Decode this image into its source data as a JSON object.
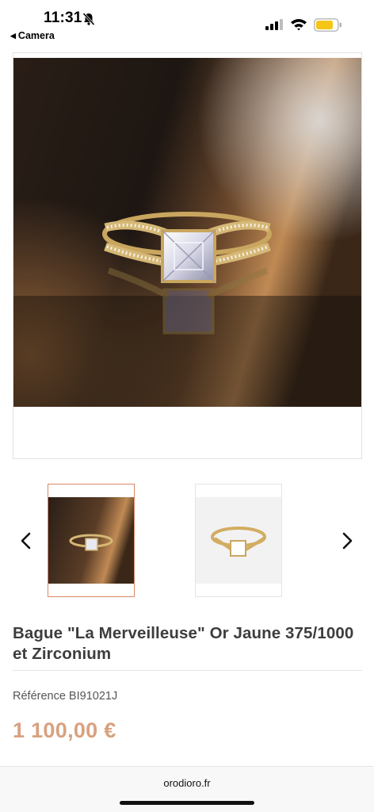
{
  "status_bar": {
    "time": "11:31",
    "back_label": "Camera",
    "icons": [
      "bell-slash-icon",
      "cellular-signal-icon",
      "wifi-icon",
      "battery-icon"
    ],
    "battery_color": "#f5c518"
  },
  "gallery": {
    "main_image": "ring-photo",
    "thumbnails": [
      {
        "name": "thumb-ring-dark",
        "selected": true
      },
      {
        "name": "thumb-ring-white",
        "selected": false
      }
    ],
    "prev_icon": "chevron-left-icon",
    "next_icon": "chevron-right-icon"
  },
  "product": {
    "title": "Bague \"La Merveilleuse\" Or Jaune 375/1000 et Zirconium",
    "reference": "Référence BI91021J",
    "price": "1 100,00 €"
  },
  "browser": {
    "url": "orodioro.fr"
  },
  "colors": {
    "accent_price": "#d8a17f",
    "thumb_selected_border": "#d9876a"
  }
}
